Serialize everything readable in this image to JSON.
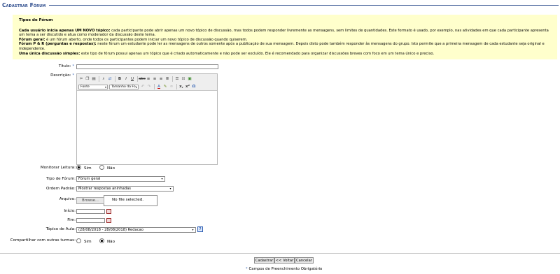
{
  "header": {
    "title": "Cadastrar Fórum"
  },
  "info": {
    "heading": "Tipos de Fórum",
    "p1_bold": "Cada usuário inicia apenas UM NOVO tópico:",
    "p1_text": " cada participante pode abrir apenas um novo tópico de discussão, mas todos podem responder livremente as mensagens, sem limites de quantidades. Este formato é usado, por exemplo, nas atividades em que cada participante apresenta um tema a ser discutido e atua como moderador da discussão deste tema.",
    "p2_bold": "Fórum geral:",
    "p2_text": " é um fórum aberto, onde todos os participantes podem iniciar um novo tópico de discussão quando quiserem.",
    "p3_bold": "Fórum P & R (perguntas e respostas):",
    "p3_text": " neste fórum um estudante pode ler as mensagens de outros somente após a publicação de sua mensagem. Depois disto pode também responder às mensagens do grupo. Isto permite que a primeira mensagem de cada estudante seja original e independente.",
    "p4_bold": "Uma única discussão simples:",
    "p4_text": " este tipo de fórum possui apenas um tópico que é criado automaticamente e não pode ser excluído. Ele é recomendado para organizar discussões breves com foco em um tema único e preciso."
  },
  "form": {
    "titulo_label": "Título:",
    "titulo_value": "",
    "descricao_label": "Descrição:",
    "editor": {
      "font_select": "Fonte",
      "size_select": "Tamanho da Fo",
      "tools_row1": [
        "cut-icon",
        "copy-icon",
        "paste-icon",
        "find-icon",
        "replace-icon",
        "bold-icon",
        "italic-icon",
        "underline-icon",
        "strikethrough-icon",
        "align-left-icon",
        "align-center-icon",
        "align-right-icon",
        "justify-icon",
        "bullet-list-icon",
        "numbered-list-icon",
        "insert-image-icon"
      ],
      "tools_row2": [
        "undo-icon",
        "redo-icon",
        "text-color-icon",
        "highlight-icon",
        "link-icon",
        "subscript-icon",
        "superscript-icon",
        "omega-icon"
      ]
    },
    "monitorar_label": "Monitorar Leitura:",
    "monitorar_options": [
      "Sim",
      "Não"
    ],
    "monitorar_selected": "Sim",
    "tipo_label": "Tipo de Fórum:",
    "tipo_value": "Fórum geral",
    "ordem_label": "Ordem Padrão:",
    "ordem_value": "Mostrar respostas aninhadas",
    "arquivo_label": "Arquivo:",
    "browse_label": "Browse...",
    "file_status": "No file selected.",
    "inicio_label": "Início:",
    "fim_label": "Fim:",
    "topico_label": "Tópico de Aula:",
    "topico_value": "(28/08/2018 - 28/08/2018) Redacao",
    "help_label": "?",
    "compartilhar_label": "Compartilhar com outras turmas:",
    "compartilhar_options": [
      "Sim",
      "Não"
    ],
    "compartilhar_selected": "Não"
  },
  "actions": {
    "cadastrar": "Cadastrar",
    "voltar": "<< Voltar",
    "cancelar": "Cancelar"
  },
  "footnote": "Campos de Preenchimento Obrigatório",
  "required_marker": "*",
  "colors": {
    "accent": "#2b4a8b",
    "info_bg": "#ffffcc",
    "required": "#2f5fb3"
  }
}
